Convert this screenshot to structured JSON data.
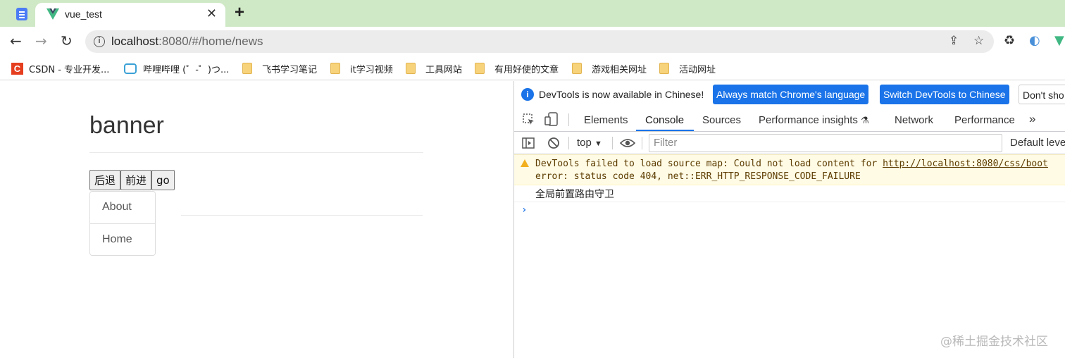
{
  "browser": {
    "tab_title": "vue_test",
    "tab_close": "✕",
    "new_tab": "+",
    "url_host": "localhost",
    "url_rest": ":8080/#/home/news",
    "bookmarks": [
      {
        "label": "CSDN - 专业开发...",
        "icon": "csdn-icon"
      },
      {
        "label": "哔哩哔哩 (゜-゜)つ...",
        "icon": "bilibili-icon"
      },
      {
        "label": "飞书学习笔记",
        "icon": "folder-icon"
      },
      {
        "label": "it学习视频",
        "icon": "folder-icon"
      },
      {
        "label": "工具网站",
        "icon": "folder-icon"
      },
      {
        "label": "有用好使的文章",
        "icon": "folder-icon"
      },
      {
        "label": "游戏相关网址",
        "icon": "folder-icon"
      },
      {
        "label": "活动网址",
        "icon": "folder-icon"
      }
    ]
  },
  "page": {
    "banner": "banner",
    "buttons": {
      "back": "后退",
      "forward": "前进",
      "go": "go"
    },
    "nav": [
      {
        "label": "About"
      },
      {
        "label": "Home"
      }
    ]
  },
  "devtools": {
    "infobar": {
      "text": "DevTools is now available in Chinese!",
      "match_btn": "Always match Chrome's language",
      "switch_btn": "Switch DevTools to Chinese",
      "dont_btn": "Don't sho"
    },
    "tabs": [
      "Elements",
      "Console",
      "Sources",
      "Performance insights",
      "Network",
      "Performance"
    ],
    "active_tab": "Console",
    "console_toolbar": {
      "context": "top",
      "filter_placeholder": "Filter",
      "levels": "Default levels"
    },
    "messages": {
      "warning_line1_prefix": "DevTools failed to load source map: Could not load content for ",
      "warning_link": "http://localhost:8080/css/boot",
      "warning_line2": "error: status code 404, net::ERR_HTTP_RESPONSE_CODE_FAILURE",
      "log": "全局前置路由守卫"
    },
    "prompt": "›"
  },
  "watermark": "@稀土掘金技术社区",
  "colors": {
    "tab_strip": "#cfe8c5",
    "accent": "#1a73e8",
    "warning_bg": "#fffbe5"
  }
}
